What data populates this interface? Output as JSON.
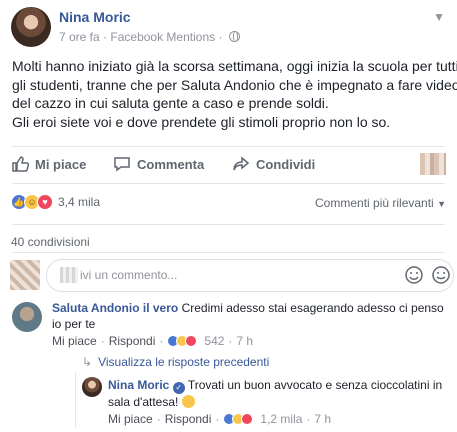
{
  "post": {
    "author": "Nina Moric",
    "time": "7 ore fa",
    "source": "Facebook Mentions",
    "text": "Molti hanno iniziato già la scorsa settimana, oggi inizia la scuola per tutti\ngli studenti, tranne che per Saluta Andonio che è impegnato a fare video\ndel cazzo in cui saluta gente a caso e prende soldi.\nGli eroi siete voi e dove prendete gli stimoli proprio non lo so."
  },
  "actions": {
    "like": "Mi piace",
    "comment": "Commenta",
    "share": "Condividi"
  },
  "stats": {
    "reactions_count": "3,4 mila",
    "sort_label": "Commenti più rilevanti",
    "shares": "40 condivisioni"
  },
  "composer": {
    "placeholder": "ivi un commento..."
  },
  "comments": [
    {
      "author": "Saluta Andonio il vero",
      "text_line1": "Credimi adesso stai esagerando adesso ci penso",
      "text_line2": "io per te",
      "like": "Mi piace",
      "reply": "Rispondi",
      "reactions": "542",
      "time": "7 h"
    }
  ],
  "replies": {
    "view_label": "Visualizza le risposte precedenti",
    "items": [
      {
        "author": "Nina Moric",
        "text_line1": "Trovati un buon avvocato e senza cioccolatini in",
        "text_line2": "sala d'attesa!",
        "like": "Mi piace",
        "reply": "Rispondi",
        "reactions": "1,2 mila",
        "time": "7 h"
      }
    ]
  },
  "colors": {
    "link_blue": "#365899",
    "like_blue": "#4a76d6",
    "love_red": "#f0475e",
    "haha_yellow": "#f7c64b"
  }
}
